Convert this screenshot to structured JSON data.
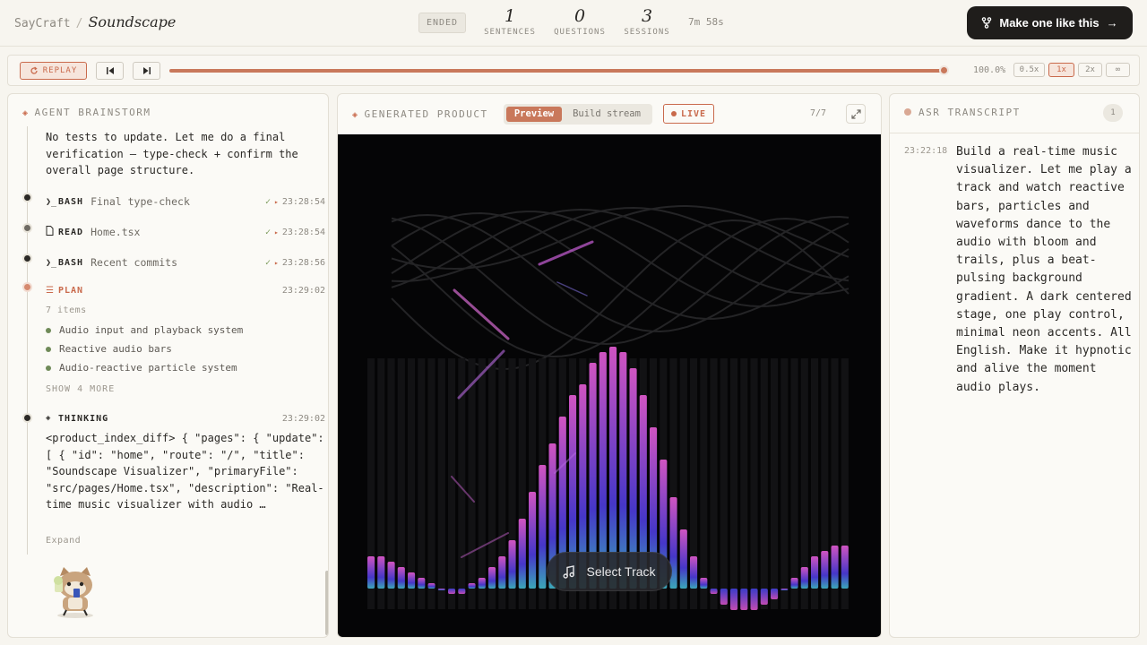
{
  "header": {
    "brand": "SayCraft",
    "separator": "/",
    "project": "Soundscape",
    "status": "ENDED",
    "stats": [
      {
        "value": "1",
        "label": "SENTENCES"
      },
      {
        "value": "0",
        "label": "QUESTIONS"
      },
      {
        "value": "3",
        "label": "SESSIONS"
      }
    ],
    "duration": "7m 58s",
    "cta_label": "Make one like this",
    "cta_arrow": "→"
  },
  "replay": {
    "replay_label": "REPLAY",
    "progress": 1.0,
    "percent_label": "100.0%",
    "speeds": [
      "0.5x",
      "1x",
      "2x",
      "∞"
    ],
    "active_speed": "1x"
  },
  "agent": {
    "title": "AGENT BRAINSTORM",
    "intro_text": "No tests to update. Let me do a final verification — type-check + confirm the overall page structure.",
    "tools": [
      {
        "icon": "terminal-icon",
        "kind": "BASH",
        "desc": "Final type-check",
        "check": "✓",
        "arrow": "▸",
        "time": "23:28:54"
      },
      {
        "icon": "file-icon",
        "kind": "READ",
        "desc": "Home.tsx",
        "check": "✓",
        "arrow": "▸",
        "time": "23:28:54"
      },
      {
        "icon": "terminal-icon",
        "kind": "BASH",
        "desc": "Recent commits",
        "check": "✓",
        "arrow": "▸",
        "time": "23:28:56"
      }
    ],
    "plan": {
      "label": "PLAN",
      "time": "23:29:02",
      "count": "7 items",
      "items": [
        "Audio input and playback system",
        "Reactive audio bars",
        "Audio-reactive particle system"
      ],
      "more": "SHOW 4 MORE"
    },
    "thinking": {
      "label": "THINKING",
      "time": "23:29:02",
      "text": "<product_index_diff> { \"pages\": { \"update\": [ { \"id\": \"home\", \"route\": \"/\", \"title\": \"Soundscape Visualizer\", \"primaryFile\": \"src/pages/Home.tsx\", \"description\": \"Real-time music visualizer with audio …",
      "expand": "Expand"
    }
  },
  "product": {
    "title": "GENERATED PRODUCT",
    "tabs": [
      "Preview",
      "Build stream"
    ],
    "active_tab": "Preview",
    "live_label": "LIVE",
    "page_count": "7/7",
    "select_track_label": "Select Track",
    "spectrum_levels": [
      0.06,
      0.06,
      0.05,
      0.04,
      0.03,
      0.02,
      0.01,
      0.0,
      -0.01,
      -0.01,
      0.01,
      0.02,
      0.04,
      0.06,
      0.09,
      0.13,
      0.18,
      0.23,
      0.27,
      0.32,
      0.36,
      0.38,
      0.42,
      0.44,
      0.45,
      0.44,
      0.41,
      0.36,
      0.3,
      0.24,
      0.17,
      0.11,
      0.06,
      0.02,
      -0.01,
      -0.03,
      -0.04,
      -0.04,
      -0.04,
      -0.03,
      -0.02,
      0.0,
      0.02,
      0.04,
      0.06,
      0.07,
      0.08,
      0.08
    ],
    "colors": {
      "accent": "#c9785b",
      "bar_top": "#e05ad0",
      "bar_mid": "#4a3ad8",
      "bar_low": "#3fb3c6"
    }
  },
  "asr": {
    "title": "ASR TRANSCRIPT",
    "count": "1",
    "entries": [
      {
        "time": "23:22:18",
        "text": "Build a real-time music visualizer. Let me play a track and watch reactive bars, particles and waveforms dance to the audio with bloom and trails, plus a beat-pulsing background gradient. A dark centered stage, one play control, minimal neon accents. All English. Make it hypnotic and alive the moment audio plays."
      }
    ]
  }
}
